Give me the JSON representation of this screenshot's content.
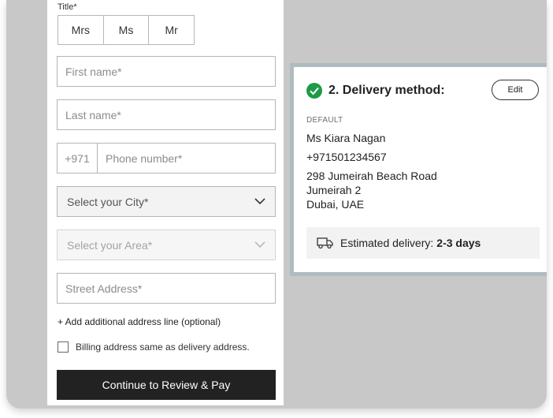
{
  "form": {
    "title_label": "Title*",
    "title_options": [
      "Mrs",
      "Ms",
      "Mr"
    ],
    "first_name_placeholder": "First name*",
    "last_name_placeholder": "Last name*",
    "phone_prefix": "+971",
    "phone_placeholder": "Phone number*",
    "city_select": "Select your City*",
    "area_select": "Select your Area*",
    "street_placeholder": "Street Address*",
    "add_address_line": "+ Add additional address line (optional)",
    "billing_checkbox_label": "Billing address same as delivery address.",
    "continue_button": "Continue to Review & Pay"
  },
  "delivery": {
    "title": "2. Delivery method:",
    "edit_label": "Edit",
    "default_label": "DEFAULT",
    "name": "Ms Kiara Nagan",
    "phone": "+971501234567",
    "address_line1": "298 Jumeirah Beach Road",
    "address_line2": "Jumeirah 2",
    "address_line3": "Dubai, UAE",
    "estimated_label": "Estimated delivery:",
    "estimated_value": "2-3 days"
  },
  "colors": {
    "accent_green": "#1e9a46",
    "button_dark": "#222222",
    "backdrop": "#c8c8c8"
  },
  "icons": {
    "check": "check-circle-icon",
    "truck": "truck-icon",
    "chevron": "chevron-down-icon"
  }
}
